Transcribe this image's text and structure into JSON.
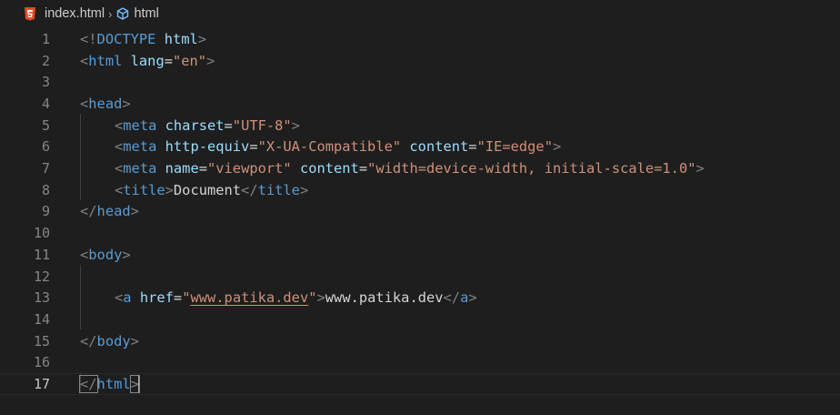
{
  "breadcrumb": {
    "file": "index.html",
    "separator": "›",
    "symbol": "html"
  },
  "editor": {
    "current_line": 17,
    "lines": [
      {
        "n": "1"
      },
      {
        "n": "2"
      },
      {
        "n": "3"
      },
      {
        "n": "4"
      },
      {
        "n": "5"
      },
      {
        "n": "6"
      },
      {
        "n": "7"
      },
      {
        "n": "8"
      },
      {
        "n": "9"
      },
      {
        "n": "10"
      },
      {
        "n": "11"
      },
      {
        "n": "12"
      },
      {
        "n": "13"
      },
      {
        "n": "14"
      },
      {
        "n": "15"
      },
      {
        "n": "16"
      },
      {
        "n": "17"
      }
    ],
    "tokens": {
      "l1": [
        "<!",
        "DOCTYPE",
        " ",
        "html",
        ">"
      ],
      "l2": [
        "<",
        "html",
        " ",
        "lang",
        "=",
        "\"en\"",
        ">"
      ],
      "l4": [
        "<",
        "head",
        ">"
      ],
      "l5": [
        "<",
        "meta",
        " ",
        "charset",
        "=",
        "\"UTF-8\"",
        ">"
      ],
      "l6": [
        "<",
        "meta",
        " ",
        "http-equiv",
        "=",
        "\"X-UA-Compatible\"",
        " ",
        "content",
        "=",
        "\"IE=edge\"",
        ">"
      ],
      "l7": [
        "<",
        "meta",
        " ",
        "name",
        "=",
        "\"viewport\"",
        " ",
        "content",
        "=",
        "\"width=device-width, initial-scale=1.0\"",
        ">"
      ],
      "l8": [
        "<",
        "title",
        ">",
        "Document",
        "</",
        "title",
        ">"
      ],
      "l9": [
        "</",
        "head",
        ">"
      ],
      "l11": [
        "<",
        "body",
        ">"
      ],
      "l13": [
        "<",
        "a",
        " ",
        "href",
        "=",
        "\"",
        "www.patika.dev",
        "\"",
        ">",
        "www.patika.dev",
        "</",
        "a",
        ">"
      ],
      "l15": [
        "</",
        "body",
        ">"
      ],
      "l17": [
        "</",
        "html",
        ">"
      ]
    }
  }
}
